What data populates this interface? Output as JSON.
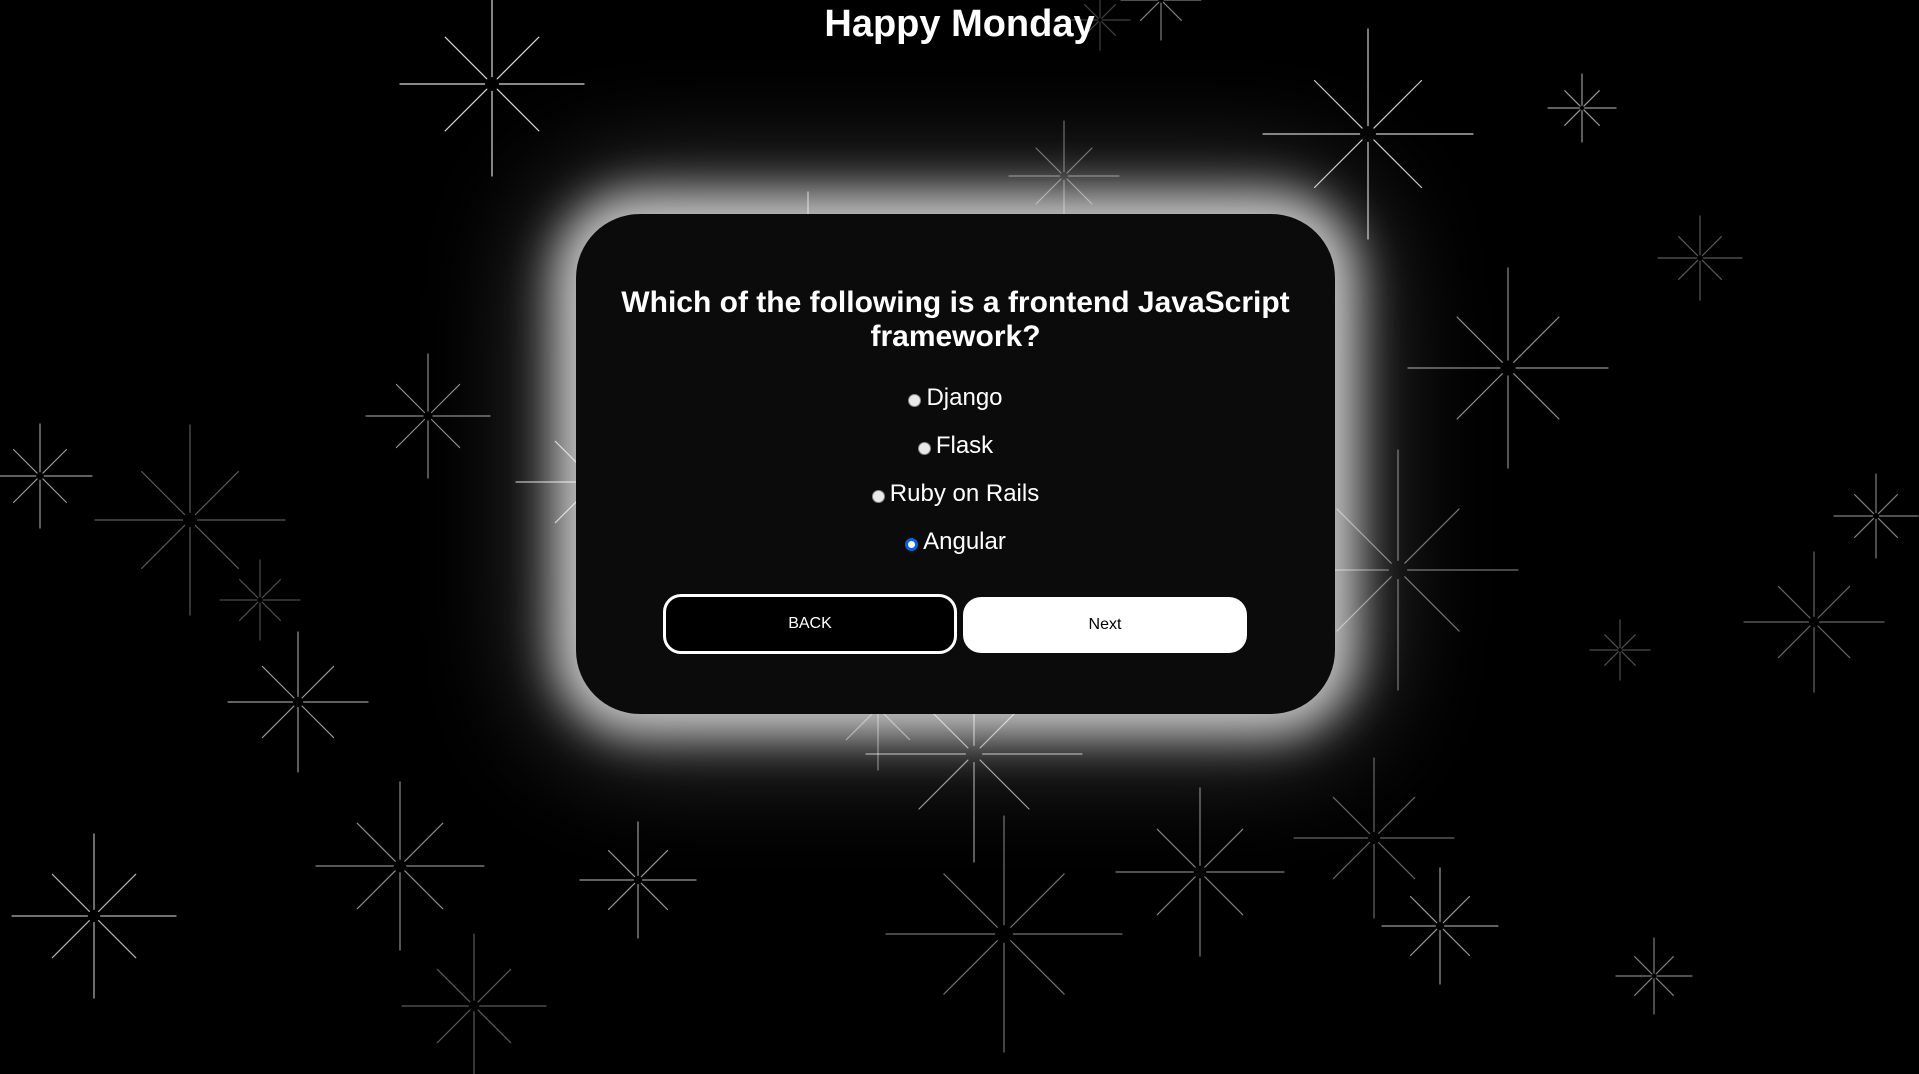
{
  "page": {
    "title": "Happy Monday"
  },
  "quiz": {
    "question": "Which of the following is a frontend JavaScript framework?",
    "options": [
      {
        "label": "Django",
        "selected": false
      },
      {
        "label": "Flask",
        "selected": false
      },
      {
        "label": "Ruby on Rails",
        "selected": false
      },
      {
        "label": "Angular",
        "selected": true
      }
    ],
    "back_label": "BACK",
    "next_label": "Next"
  },
  "colors": {
    "background": "#000000",
    "card": "#0b0b0b",
    "glow": "#ffffff",
    "radio_selected": "#0a63d6"
  }
}
